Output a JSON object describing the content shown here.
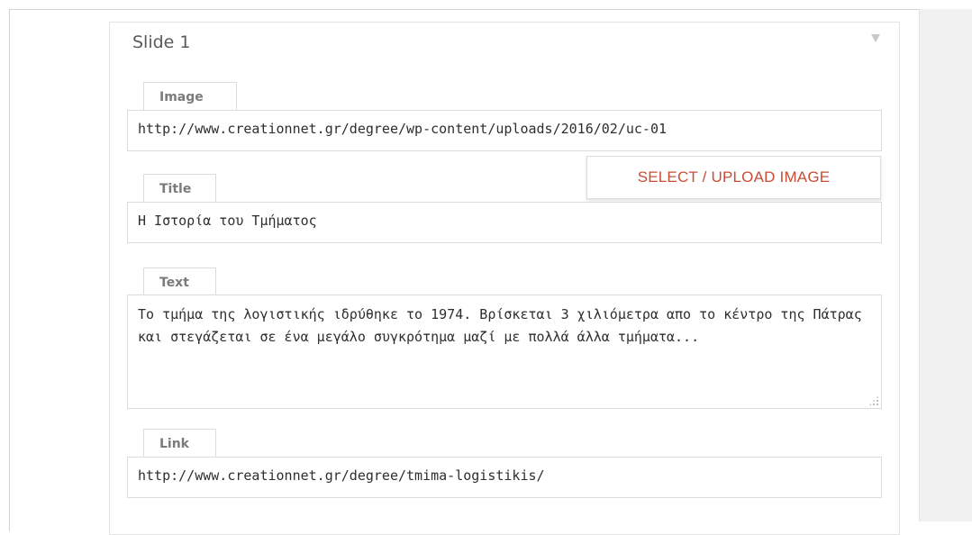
{
  "slide": {
    "title": "Slide 1",
    "toggle_icon": "triangle-down-icon"
  },
  "fields": {
    "image": {
      "label": "Image",
      "value": "http://www.creationnet.gr/degree/wp-content/uploads/2016/02/uc-01"
    },
    "upload_button_label": "SELECT / UPLOAD IMAGE",
    "title": {
      "label": "Title",
      "value": "Η Ιστορία του Τμήματος"
    },
    "text": {
      "label": "Text",
      "value": "Το τμήμα της λογιστικής ιδρύθηκε το 1974. Βρίσκεται 3 χιλιόμετρα απο το κέντρο της Πάτρας και στεγάζεται σε ένα μεγάλο συγκρότημα μαζί με πολλά άλλα τμήματα..."
    },
    "link": {
      "label": "Link",
      "value": "http://www.creationnet.gr/degree/tmima-logistikis/"
    }
  },
  "colors": {
    "accent": "#c84d35",
    "border": "#dcdcdc",
    "label_text": "#7b7b7b"
  }
}
